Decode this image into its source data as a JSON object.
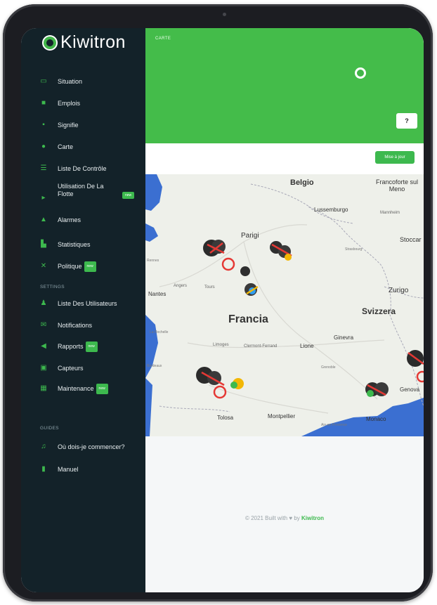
{
  "app": {
    "name": "Kiwitron"
  },
  "header": {
    "breadcrumb": "CARTE",
    "help_label": "?",
    "action_button": "Mise à jour"
  },
  "sidebar": {
    "items": [
      {
        "label": "Situation",
        "icon": "monitor-icon"
      },
      {
        "label": "Emplois",
        "icon": "briefcase-icon"
      },
      {
        "label": "Signifie",
        "icon": "vehicle-icon"
      },
      {
        "label": "Carte",
        "icon": "map-pin-icon"
      },
      {
        "label": "Liste De Contrôle",
        "icon": "checklist-icon"
      },
      {
        "label": "Utilisation De La Flotte",
        "icon": "fleet-icon",
        "badge": "new"
      },
      {
        "label": "Alarmes",
        "icon": "bell-icon"
      },
      {
        "label": "Statistiques",
        "icon": "chart-icon"
      },
      {
        "label": "Politique",
        "icon": "wrench-icon",
        "badge": "new"
      }
    ],
    "settings_title": "SETTINGS",
    "settings_items": [
      {
        "label": "Liste Des Utilisateurs",
        "icon": "users-icon"
      },
      {
        "label": "Notifications",
        "icon": "envelope-icon"
      },
      {
        "label": "Rapports",
        "icon": "megaphone-icon",
        "badge": "new"
      },
      {
        "label": "Capteurs",
        "icon": "sensor-icon"
      },
      {
        "label": "Maintenance",
        "icon": "calendar-icon",
        "badge": "new"
      }
    ],
    "guides_title": "GUIDES",
    "guides_items": [
      {
        "label": "Où dois-je commencer?",
        "icon": "music-icon"
      },
      {
        "label": "Manuel",
        "icon": "book-icon"
      }
    ]
  },
  "map": {
    "labels": {
      "belgio": "Belgio",
      "francoforte": "Francoforte sul Meno",
      "lussemburgo": "Lussemburgo",
      "mannheim": "Mannheim",
      "parigi": "Parigi",
      "stoccarda": "Stoccar",
      "strasburgo": "Strasbourg",
      "zurigo": "Zurigo",
      "svizzera": "Svizzera",
      "francia": "Francia",
      "nantes": "Nantes",
      "angers": "Angers",
      "tours": "Tours",
      "rennes": "Rennes",
      "limoges": "Limoges",
      "clermont": "Clermont-Ferrand",
      "lione": "Lione",
      "ginevra": "Ginevra",
      "grenoble": "Grenoble",
      "bordeaux": "Bordeaux",
      "larochelle": "La Rochelle",
      "tolosa": "Tolosa",
      "montpellier": "Montpellier",
      "monaco": "Monaco",
      "genova": "Genova",
      "aix": "Aix-en-Provence"
    }
  },
  "footer": {
    "text": "© 2021 Built with ♥ by",
    "brand": "Kiwitron"
  },
  "colors": {
    "accent": "#3db94e",
    "sidebar_bg": "#132229",
    "sea": "#3b6fd1"
  }
}
